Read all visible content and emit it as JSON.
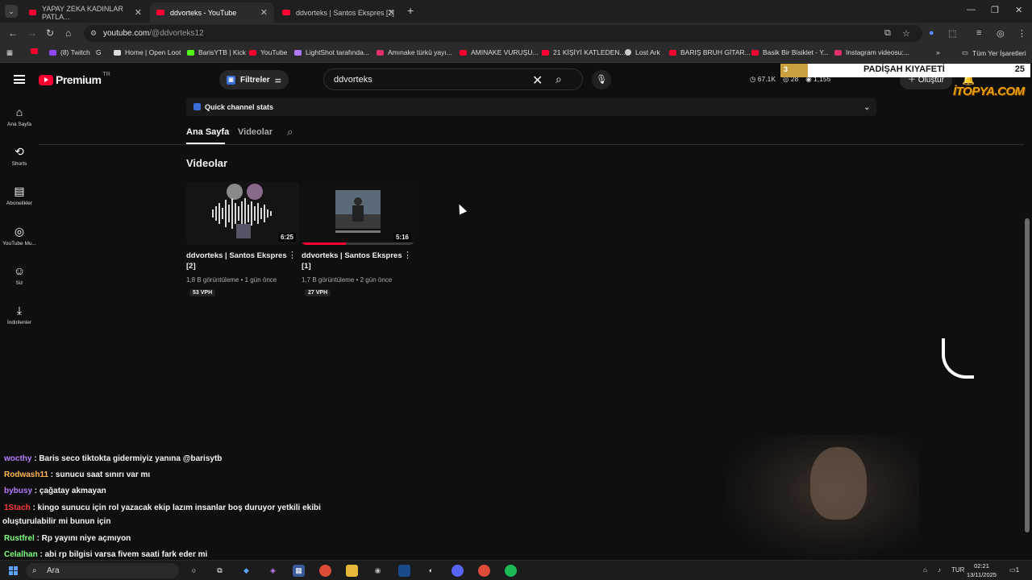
{
  "browser": {
    "tabs": [
      {
        "title": "YAPAY ZEKA KADINLAR PATLA..."
      },
      {
        "title": "ddvorteks - YouTube"
      },
      {
        "title": "ddvorteks | Santos Ekspres [2]"
      }
    ],
    "url_host": "youtube.com",
    "url_path": "/@ddvorteks12",
    "bookmarks": [
      {
        "label": "(8) Twitch",
        "color": "#9146ff"
      },
      {
        "label": "Home | Open Loot",
        "color": "#dddddd"
      },
      {
        "label": "BarisYTB | Kick",
        "color": "#53fc18"
      },
      {
        "label": "YouTube",
        "color": "#ff0033"
      },
      {
        "label": "LightShot tarafında...",
        "color": "#b27bff"
      },
      {
        "label": "Amınake türkü yayı...",
        "color": "#e1306c"
      },
      {
        "label": "AMINAKE VURUŞU...",
        "color": "#ff0033"
      },
      {
        "label": "21 KİŞİYİ KATLEDEN...",
        "color": "#ff0033"
      },
      {
        "label": "Lost Ark",
        "color": "#cccccc"
      },
      {
        "label": "BARIŞ BRUH GİTAR...",
        "color": "#ff0033"
      },
      {
        "label": "Basik Bir Bisiklet - Y...",
        "color": "#ff0033"
      },
      {
        "label": "Instagram videosu:...",
        "color": "#e1306c"
      }
    ],
    "all_bookmarks_label": "Tüm Yer İşaretleri"
  },
  "youtube": {
    "logo_text": "Premium",
    "logo_region": "TR",
    "filters_label": "Filtreler",
    "search_query": "ddvorteks",
    "header_stats": [
      "67.1K",
      "28",
      "1,155"
    ],
    "create_label": "Oluştur",
    "sidenav": [
      {
        "label": "Ana Sayfa",
        "icon": "home-icon"
      },
      {
        "label": "Shorts",
        "icon": "shorts-icon"
      },
      {
        "label": "Abonelikler",
        "icon": "subscriptions-icon"
      },
      {
        "label": "YouTube Mu...",
        "icon": "youtube-music-icon"
      },
      {
        "label": "Siz",
        "icon": "you-icon"
      },
      {
        "label": "İndirilenler",
        "icon": "download-icon"
      }
    ],
    "quick_stats_label": "Quick channel stats",
    "channel_tabs": [
      "Ana Sayfa",
      "Videolar"
    ],
    "section_title": "Videolar",
    "videos": [
      {
        "title": "ddvorteks | Santos Ekspres [2]",
        "duration": "6:25",
        "views": "1,8 B görüntüleme",
        "age": "1 gün önce",
        "vph": "53 VPH"
      },
      {
        "title": "ddvorteks | Santos Ekspres [1]",
        "duration": "5:16",
        "views": "1,7 B görüntüleme",
        "age": "2 gün önce",
        "vph": "27 VPH"
      }
    ]
  },
  "overlay": {
    "rank_left": "3",
    "rank_title": "PADİŞAH KIYAFETİ",
    "rank_right": "25",
    "brand": "İTOPYA.COM"
  },
  "chat": [
    {
      "user": "wocthy",
      "color": "#b57bff",
      "text": " : Baris seco tiktokta gidermiyiz yanına @barisytb"
    },
    {
      "user": "Rodwash11",
      "color": "#ffb74d",
      "text": " : sunucu saat sınırı var mı"
    },
    {
      "user": "bybusy",
      "color": "#b57bff",
      "text": " : çağatay akmayan"
    },
    {
      "user": "1Stach",
      "color": "#ff3b3b",
      "text": " : kingo sunucu için rol yazacak ekip lazım insanlar boş duruyor yetkili ekibi"
    },
    {
      "user": "",
      "color": "#ffffff",
      "text": "oluşturulabilir mi bunun için"
    },
    {
      "user": "Rustfrel",
      "color": "#7cff7c",
      "text": " : Rp yayını niye açmıyon"
    },
    {
      "user": "Celalhan",
      "color": "#7cff7c",
      "text": " : abi rp bilgisi varsa fivem saati fark eder mi"
    }
  ],
  "taskbar": {
    "search_label": "Ara",
    "lang": "TUR",
    "time": "02:21",
    "date": "13/11/2025",
    "notifications": "1"
  }
}
